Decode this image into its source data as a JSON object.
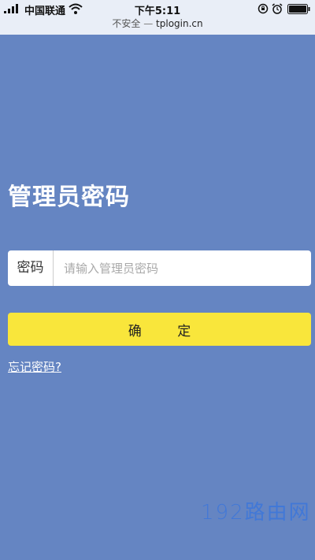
{
  "status_bar": {
    "carrier": "中国联通",
    "time": "下午5:11",
    "icons": [
      "signal-icon",
      "wifi-icon",
      "orientation-lock-icon",
      "alarm-icon",
      "battery-icon"
    ]
  },
  "url_bar": {
    "security": "不安全",
    "separator": "—",
    "domain": "tplogin.cn"
  },
  "main": {
    "title": "管理员密码",
    "password_label": "密码",
    "password_placeholder": "请输入管理员密码",
    "password_value": "",
    "confirm_label": "确 定",
    "forgot_label": "忘记密码?"
  },
  "watermark": "192路由网",
  "colors": {
    "background": "#6585c2",
    "button": "#f9e63b"
  }
}
